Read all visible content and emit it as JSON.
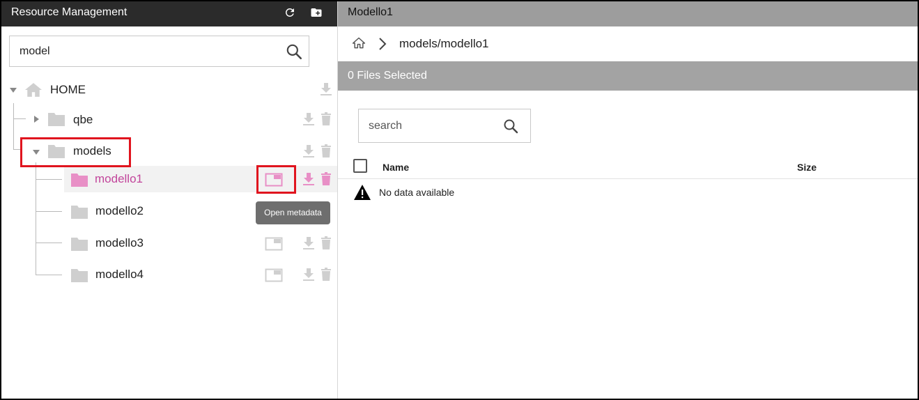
{
  "left_panel": {
    "title": "Resource Management",
    "header_icons": [
      "refresh-icon",
      "new-folder-icon"
    ],
    "search": {
      "value": "model",
      "icon": "search-icon"
    },
    "tree": {
      "root": {
        "label": "HOME",
        "icon": "home-icon",
        "expanded": true
      },
      "nodes": [
        {
          "label": "qbe",
          "expanded": false
        },
        {
          "label": "models",
          "expanded": true
        },
        {
          "label": "modello1",
          "selected": true
        },
        {
          "label": "modello2"
        },
        {
          "label": "modello3"
        },
        {
          "label": "modello4"
        }
      ]
    },
    "tooltip": "Open metadata"
  },
  "right_panel": {
    "title": "Modello1",
    "breadcrumb": {
      "home_icon": "home-outline-icon",
      "separator_icon": "chevron-right-icon",
      "path": "models/modello1"
    },
    "selection_bar": "0 Files Selected",
    "search": {
      "placeholder": "search",
      "value": "",
      "icon": "search-icon"
    },
    "table": {
      "columns": [
        "Name",
        "Size"
      ],
      "empty_message": "No data available",
      "empty_icon": "warning-icon"
    }
  },
  "colors": {
    "header_dark": "#2b2b2b",
    "header_gray": "#9d9d9d",
    "selection_bar": "#a3a3a3",
    "accent_pink": "#c2459b",
    "folder_gray": "#cfcfcf",
    "folder_pink": "#e88fc6",
    "highlight_red": "#e0141e",
    "tooltip_bg": "#6e6e6e"
  }
}
